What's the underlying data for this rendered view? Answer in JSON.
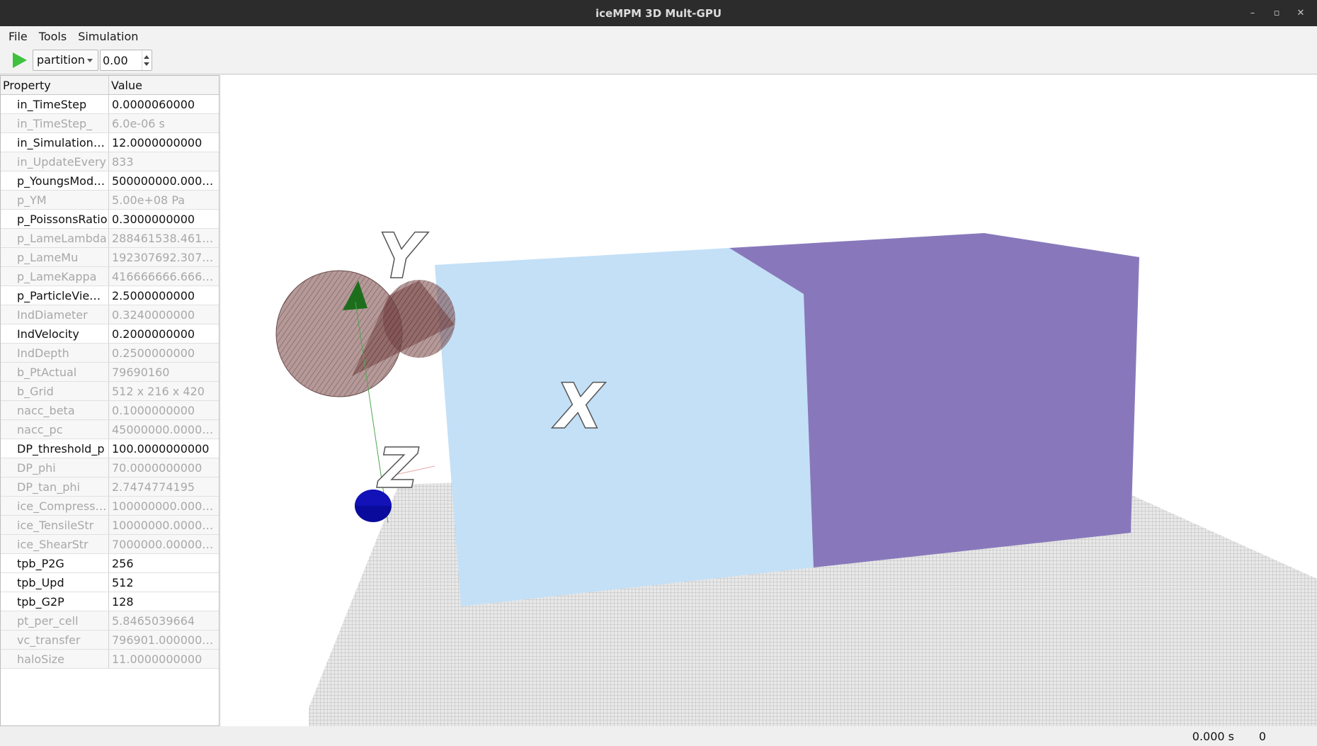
{
  "window": {
    "title": "iceMPM 3D Mult-GPU",
    "controls": {
      "minimize": "–",
      "restore": "▫",
      "close": "✕"
    }
  },
  "menu": [
    "File",
    "Tools",
    "Simulation"
  ],
  "toolbar": {
    "play_icon": "play-icon",
    "mode_select": {
      "value": "partition"
    },
    "spin_value": "0.00"
  },
  "properties": {
    "header": {
      "property": "Property",
      "value": "Value"
    },
    "rows": [
      {
        "name": "in_TimeStep",
        "value": "0.0000060000",
        "enabled": true
      },
      {
        "name": "in_TimeStep_",
        "value": "6.0e-06 s",
        "enabled": false
      },
      {
        "name": "in_SimulationTi...",
        "value": "12.0000000000",
        "enabled": true
      },
      {
        "name": "in_UpdateEvery",
        "value": "833",
        "enabled": false
      },
      {
        "name": "p_YoungsModu...",
        "value": "500000000.00000...",
        "enabled": true
      },
      {
        "name": "p_YM",
        "value": "5.00e+08 Pa",
        "enabled": false
      },
      {
        "name": "p_PoissonsRatio",
        "value": "0.3000000000",
        "enabled": true
      },
      {
        "name": "p_LameLambda",
        "value": "288461538.46153...",
        "enabled": false
      },
      {
        "name": "p_LameMu",
        "value": "192307692.30769...",
        "enabled": false
      },
      {
        "name": "p_LameKappa",
        "value": "416666666.66666...",
        "enabled": false
      },
      {
        "name": "p_ParticleView...",
        "value": "2.5000000000",
        "enabled": true
      },
      {
        "name": "IndDiameter",
        "value": "0.3240000000",
        "enabled": false
      },
      {
        "name": "IndVelocity",
        "value": "0.2000000000",
        "enabled": true
      },
      {
        "name": "IndDepth",
        "value": "0.2500000000",
        "enabled": false
      },
      {
        "name": "b_PtActual",
        "value": "79690160",
        "enabled": false
      },
      {
        "name": "b_Grid",
        "value": "512 x 216 x 420",
        "enabled": false
      },
      {
        "name": "nacc_beta",
        "value": "0.1000000000",
        "enabled": false
      },
      {
        "name": "nacc_pc",
        "value": "45000000.000000...",
        "enabled": false
      },
      {
        "name": "DP_threshold_p",
        "value": "100.0000000000",
        "enabled": true
      },
      {
        "name": "DP_phi",
        "value": "70.0000000000",
        "enabled": false
      },
      {
        "name": "DP_tan_phi",
        "value": "2.7474774195",
        "enabled": false
      },
      {
        "name": "ice_Compressiv...",
        "value": "100000000.00000...",
        "enabled": false
      },
      {
        "name": "ice_TensileStr",
        "value": "10000000.000000...",
        "enabled": false
      },
      {
        "name": "ice_ShearStr",
        "value": "7000000.0000000...",
        "enabled": false
      },
      {
        "name": "tpb_P2G",
        "value": "256",
        "enabled": true
      },
      {
        "name": "tpb_Upd",
        "value": "512",
        "enabled": true
      },
      {
        "name": "tpb_G2P",
        "value": "128",
        "enabled": true
      },
      {
        "name": "pt_per_cell",
        "value": "5.8465039664",
        "enabled": false
      },
      {
        "name": "vc_transfer",
        "value": "796901.00000000...",
        "enabled": false
      },
      {
        "name": "haloSize",
        "value": "11.0000000000",
        "enabled": false
      }
    ]
  },
  "viewport": {
    "axis_labels": {
      "x": "X",
      "y": "Y",
      "z": "Z"
    },
    "colors": {
      "block_left": "#c3e0f7",
      "block_right": "#8878bb",
      "floor": "#d2d2d2"
    }
  },
  "status": {
    "time": "0.000 s",
    "step": "0"
  }
}
